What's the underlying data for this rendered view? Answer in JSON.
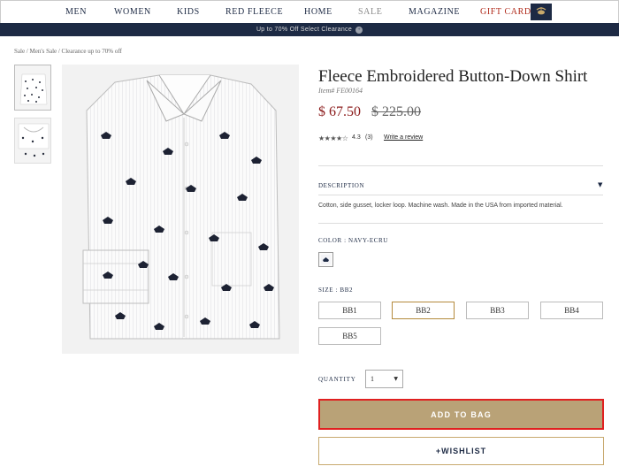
{
  "nav": {
    "items": [
      "MEN",
      "WOMEN",
      "KIDS",
      "RED FLEECE",
      "HOME",
      "SALE",
      "MAGAZINE",
      "GIFT CARDS"
    ],
    "logo_icon": "golden-fleece-logo-icon"
  },
  "banner": {
    "text": "Up to 70% Off Select Clearance"
  },
  "breadcrumb": "Sale / Men's Sale / Clearance up to 70% off",
  "product": {
    "title": "Fleece Embroidered Button-Down Shirt",
    "item_number": "Item# FE00164",
    "price": "$ 67.50",
    "original_price": "$ 225.00",
    "rating": "4.3",
    "review_count": "(3)",
    "write_review": "Write a review",
    "description_label": "DESCRIPTION",
    "description": "Cotton, side gusset, locker loop. Machine wash. Made in the USA from imported material.",
    "color_label": "COLOR :  NAVY-ECRU",
    "size_label": "SIZE : BB2",
    "sizes": [
      "BB1",
      "BB2",
      "BB3",
      "BB4",
      "BB5"
    ],
    "selected_size": "BB2",
    "quantity_label": "QUANTITY",
    "quantity_value": "1",
    "add_to_bag": "ADD TO BAG",
    "wishlist": "+WISHLIST"
  },
  "colors": {
    "navy": "#1d2a44",
    "price_red": "#8b1b1b",
    "gold": "#b9a277",
    "highlight": "#e02020"
  }
}
